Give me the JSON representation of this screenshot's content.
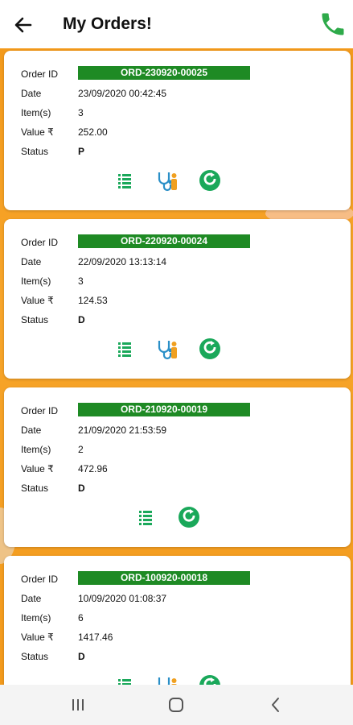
{
  "header": {
    "title": "My Orders!"
  },
  "labels": {
    "order_id": "Order ID",
    "date": "Date",
    "items": "Item(s)",
    "value": "Value ₹",
    "status": "Status"
  },
  "orders": [
    {
      "id": "ORD-230920-00025",
      "date": "23/09/2020 00:42:45",
      "items": "3",
      "value": "252.00",
      "status": "P"
    },
    {
      "id": "ORD-220920-00024",
      "date": "22/09/2020 13:13:14",
      "items": "3",
      "value": "124.53",
      "status": "D"
    },
    {
      "id": "ORD-210920-00019",
      "date": "21/09/2020 21:53:59",
      "items": "2",
      "value": "472.96",
      "status": "D"
    },
    {
      "id": "ORD-100920-00018",
      "date": "10/09/2020 01:08:37",
      "items": "6",
      "value": "1417.46",
      "status": "D"
    }
  ],
  "icons": {
    "back": "arrow-left-icon",
    "phone": "phone-icon",
    "list": "list-icon",
    "doctor": "doctor-stethoscope-icon",
    "reorder": "reorder-icon"
  },
  "colors": {
    "accent_green": "#1e8a24",
    "icon_green": "#1aa85a",
    "background_orange": "#f39a1c"
  }
}
